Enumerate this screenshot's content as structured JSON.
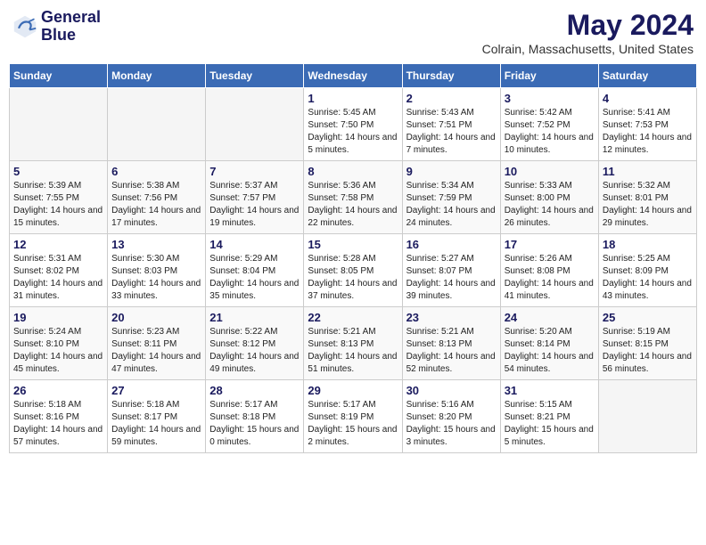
{
  "header": {
    "logo_line1": "General",
    "logo_line2": "Blue",
    "month_year": "May 2024",
    "location": "Colrain, Massachusetts, United States"
  },
  "weekdays": [
    "Sunday",
    "Monday",
    "Tuesday",
    "Wednesday",
    "Thursday",
    "Friday",
    "Saturday"
  ],
  "weeks": [
    [
      {
        "day": "",
        "info": ""
      },
      {
        "day": "",
        "info": ""
      },
      {
        "day": "",
        "info": ""
      },
      {
        "day": "1",
        "info": "Sunrise: 5:45 AM\nSunset: 7:50 PM\nDaylight: 14 hours and 5 minutes."
      },
      {
        "day": "2",
        "info": "Sunrise: 5:43 AM\nSunset: 7:51 PM\nDaylight: 14 hours and 7 minutes."
      },
      {
        "day": "3",
        "info": "Sunrise: 5:42 AM\nSunset: 7:52 PM\nDaylight: 14 hours and 10 minutes."
      },
      {
        "day": "4",
        "info": "Sunrise: 5:41 AM\nSunset: 7:53 PM\nDaylight: 14 hours and 12 minutes."
      }
    ],
    [
      {
        "day": "5",
        "info": "Sunrise: 5:39 AM\nSunset: 7:55 PM\nDaylight: 14 hours and 15 minutes."
      },
      {
        "day": "6",
        "info": "Sunrise: 5:38 AM\nSunset: 7:56 PM\nDaylight: 14 hours and 17 minutes."
      },
      {
        "day": "7",
        "info": "Sunrise: 5:37 AM\nSunset: 7:57 PM\nDaylight: 14 hours and 19 minutes."
      },
      {
        "day": "8",
        "info": "Sunrise: 5:36 AM\nSunset: 7:58 PM\nDaylight: 14 hours and 22 minutes."
      },
      {
        "day": "9",
        "info": "Sunrise: 5:34 AM\nSunset: 7:59 PM\nDaylight: 14 hours and 24 minutes."
      },
      {
        "day": "10",
        "info": "Sunrise: 5:33 AM\nSunset: 8:00 PM\nDaylight: 14 hours and 26 minutes."
      },
      {
        "day": "11",
        "info": "Sunrise: 5:32 AM\nSunset: 8:01 PM\nDaylight: 14 hours and 29 minutes."
      }
    ],
    [
      {
        "day": "12",
        "info": "Sunrise: 5:31 AM\nSunset: 8:02 PM\nDaylight: 14 hours and 31 minutes."
      },
      {
        "day": "13",
        "info": "Sunrise: 5:30 AM\nSunset: 8:03 PM\nDaylight: 14 hours and 33 minutes."
      },
      {
        "day": "14",
        "info": "Sunrise: 5:29 AM\nSunset: 8:04 PM\nDaylight: 14 hours and 35 minutes."
      },
      {
        "day": "15",
        "info": "Sunrise: 5:28 AM\nSunset: 8:05 PM\nDaylight: 14 hours and 37 minutes."
      },
      {
        "day": "16",
        "info": "Sunrise: 5:27 AM\nSunset: 8:07 PM\nDaylight: 14 hours and 39 minutes."
      },
      {
        "day": "17",
        "info": "Sunrise: 5:26 AM\nSunset: 8:08 PM\nDaylight: 14 hours and 41 minutes."
      },
      {
        "day": "18",
        "info": "Sunrise: 5:25 AM\nSunset: 8:09 PM\nDaylight: 14 hours and 43 minutes."
      }
    ],
    [
      {
        "day": "19",
        "info": "Sunrise: 5:24 AM\nSunset: 8:10 PM\nDaylight: 14 hours and 45 minutes."
      },
      {
        "day": "20",
        "info": "Sunrise: 5:23 AM\nSunset: 8:11 PM\nDaylight: 14 hours and 47 minutes."
      },
      {
        "day": "21",
        "info": "Sunrise: 5:22 AM\nSunset: 8:12 PM\nDaylight: 14 hours and 49 minutes."
      },
      {
        "day": "22",
        "info": "Sunrise: 5:21 AM\nSunset: 8:13 PM\nDaylight: 14 hours and 51 minutes."
      },
      {
        "day": "23",
        "info": "Sunrise: 5:21 AM\nSunset: 8:13 PM\nDaylight: 14 hours and 52 minutes."
      },
      {
        "day": "24",
        "info": "Sunrise: 5:20 AM\nSunset: 8:14 PM\nDaylight: 14 hours and 54 minutes."
      },
      {
        "day": "25",
        "info": "Sunrise: 5:19 AM\nSunset: 8:15 PM\nDaylight: 14 hours and 56 minutes."
      }
    ],
    [
      {
        "day": "26",
        "info": "Sunrise: 5:18 AM\nSunset: 8:16 PM\nDaylight: 14 hours and 57 minutes."
      },
      {
        "day": "27",
        "info": "Sunrise: 5:18 AM\nSunset: 8:17 PM\nDaylight: 14 hours and 59 minutes."
      },
      {
        "day": "28",
        "info": "Sunrise: 5:17 AM\nSunset: 8:18 PM\nDaylight: 15 hours and 0 minutes."
      },
      {
        "day": "29",
        "info": "Sunrise: 5:17 AM\nSunset: 8:19 PM\nDaylight: 15 hours and 2 minutes."
      },
      {
        "day": "30",
        "info": "Sunrise: 5:16 AM\nSunset: 8:20 PM\nDaylight: 15 hours and 3 minutes."
      },
      {
        "day": "31",
        "info": "Sunrise: 5:15 AM\nSunset: 8:21 PM\nDaylight: 15 hours and 5 minutes."
      },
      {
        "day": "",
        "info": ""
      }
    ]
  ]
}
